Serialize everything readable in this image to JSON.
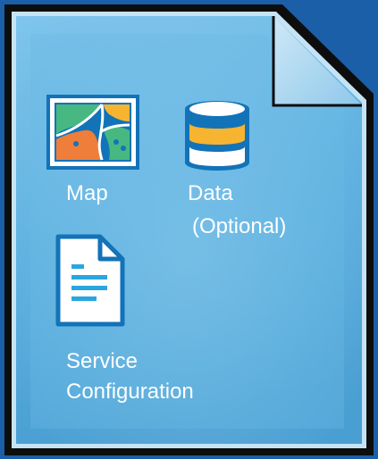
{
  "icons": {
    "map": "map-icon",
    "data": "database-icon",
    "config": "document-icon"
  },
  "labels": {
    "map": "Map",
    "data": "Data",
    "optional": "(Optional)",
    "service": "Service",
    "configuration": "Configuration"
  },
  "colors": {
    "outer_background": "#1a5fa8",
    "page_border": "#0d0d0d",
    "page_fill": "#5fb1e1",
    "icon_blue": "#1273b8",
    "db_band": "#f6b431",
    "label_text": "#ffffff"
  }
}
